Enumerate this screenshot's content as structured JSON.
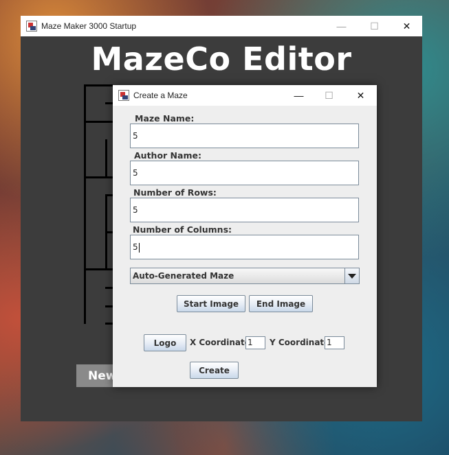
{
  "main_window": {
    "title": "Maze Maker 3000 Startup",
    "controls": {
      "minimize": "—",
      "maximize": "☐",
      "close": "✕"
    },
    "heading": "MazeCo Editor",
    "new_button_label": "New"
  },
  "dialog": {
    "title": "Create a Maze",
    "controls": {
      "minimize": "—",
      "maximize": "☐",
      "close": "✕"
    },
    "fields": {
      "maze_name": {
        "label": "Maze Name:",
        "value": "5"
      },
      "author_name": {
        "label": "Author Name:",
        "value": "5"
      },
      "rows": {
        "label": "Number of Rows:",
        "value": "5"
      },
      "columns": {
        "label": "Number of Columns:",
        "value": "5"
      }
    },
    "maze_type": {
      "selected": "Auto-Generated Maze"
    },
    "start_image_label": "Start Image",
    "end_image_label": "End Image",
    "logo_label": "Logo",
    "x_coord": {
      "label": "X Coordinate:",
      "value": "1"
    },
    "y_coord": {
      "label": "Y Coordinate:",
      "value": "1"
    },
    "create_label": "Create"
  }
}
